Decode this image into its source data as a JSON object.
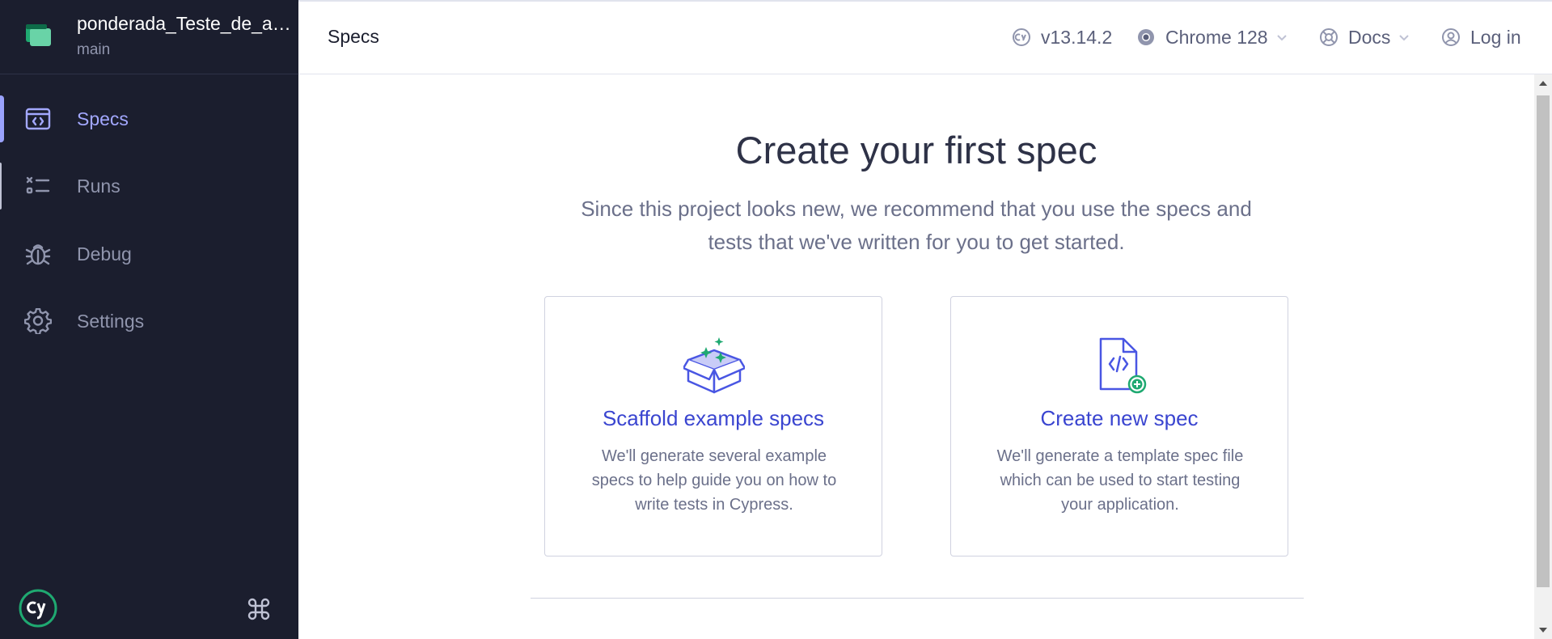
{
  "sidebar": {
    "project_name": "ponderada_Teste_de_ap...",
    "branch": "main",
    "items": [
      {
        "label": "Specs",
        "icon": "specs-icon"
      },
      {
        "label": "Runs",
        "icon": "runs-icon"
      },
      {
        "label": "Debug",
        "icon": "debug-icon"
      },
      {
        "label": "Settings",
        "icon": "gear-icon"
      }
    ]
  },
  "header": {
    "title": "Specs",
    "version": "v13.14.2",
    "browser": "Chrome 128",
    "docs": "Docs",
    "login": "Log in"
  },
  "main": {
    "title": "Create your first spec",
    "description": "Since this project looks new, we recommend that you use the specs and tests that we've written for you to get started.",
    "cards": [
      {
        "title": "Scaffold example specs",
        "description": "We'll generate several example specs to help guide you on how to write tests in Cypress.",
        "icon": "box-sparkle-icon"
      },
      {
        "title": "Create new spec",
        "description": "We'll generate a template spec file which can be used to start testing your application.",
        "icon": "new-file-icon"
      }
    ]
  },
  "colors": {
    "sidebar_bg": "#1b1e2e",
    "accent": "#3a45d0",
    "active_nav": "#a3a8ff",
    "green": "#1fa971"
  }
}
